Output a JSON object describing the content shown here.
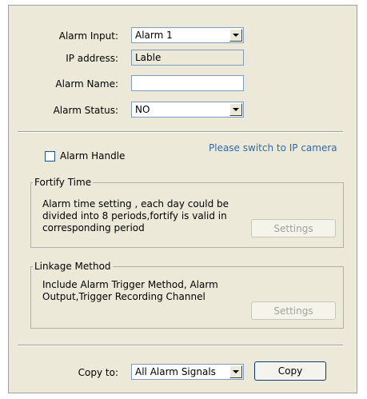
{
  "alarm_input": {
    "label": "Alarm Input:",
    "value": "Alarm 1"
  },
  "ip_address": {
    "label": "IP address:",
    "value": "Lable"
  },
  "alarm_name": {
    "label": "Alarm Name:",
    "value": ""
  },
  "alarm_status": {
    "label": "Alarm Status:",
    "value": "NO"
  },
  "alarm_handle": {
    "label": "Alarm Handle",
    "checked": false
  },
  "notice": "Please switch to IP camera",
  "fortify_time": {
    "title": "Fortify Time",
    "lines": [
      "Alarm time setting , each day could be",
      "divided into 8 periods,fortify is valid in",
      "corresponding period"
    ],
    "button": "Settings"
  },
  "linkage_method": {
    "title": "Linkage Method",
    "lines": [
      "Include Alarm Trigger Method, Alarm",
      "Output,Trigger Recording Channel"
    ],
    "button": "Settings"
  },
  "copy_to": {
    "label": "Copy to:",
    "value": "All Alarm Signals",
    "button": "Copy"
  },
  "colors": {
    "panel_bg": "#ece9d8",
    "link": "#2e6ab0",
    "disabled_text": "#a0a0a0"
  }
}
